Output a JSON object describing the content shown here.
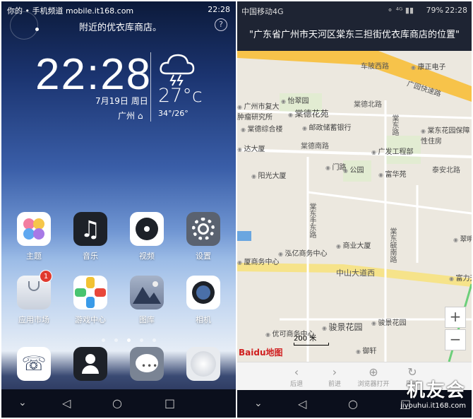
{
  "left": {
    "status": {
      "text": "你的 • 手机频道 mobile.it168.com",
      "time": "22:28"
    },
    "voice_hint": "附近的优衣库商店。",
    "help": "?",
    "clock": "22:28",
    "date": "7月19日  周日",
    "city": "广州 ⌂",
    "temp": "27°c",
    "temp_range": "34°/26°",
    "apps": [
      {
        "label": "主题"
      },
      {
        "label": "音乐"
      },
      {
        "label": "视频"
      },
      {
        "label": "设置"
      },
      {
        "label": "应用市场",
        "badge": "1"
      },
      {
        "label": "游戏中心"
      },
      {
        "label": "图库"
      },
      {
        "label": "相机"
      }
    ],
    "nav": {
      "back": "◁",
      "home": "○",
      "recent": "□",
      "down": "⌄"
    }
  },
  "right": {
    "status": {
      "carrier": "中国移动4G",
      "battery": "79%",
      "time": "22:28",
      "icons": "⚬ ⁴ᴳ ▮▮"
    },
    "header": "\"广东省广州市天河区棠东三担街优衣库商店的位置\"",
    "map": {
      "roads": [
        "车陂西路",
        "广园快速路",
        "棠德北路",
        "棠德南路",
        "中山大道西",
        "棠东路",
        "棠东手东路",
        "棠东毓南路",
        "泰安北路"
      ],
      "pois": [
        "康正电子",
        "怡翠园",
        "广州市复大肿瘤研究所",
        "棠德花苑",
        "棠德综合楼",
        "邮政储蓄银行",
        "棠东花园保障性住房",
        "达大厦",
        "广发工程部",
        "门路",
        "公园",
        "富华苑",
        "阳光大厦",
        "商业大厦",
        "泓亿商务中心",
        "厦商务中心",
        "骏景花园",
        "骏景花园",
        "富力天",
        "优可商务中心",
        "御轩",
        "翠明"
      ],
      "scale": "200 米",
      "zoom_in": "+",
      "zoom_out": "−",
      "logo": "Baidu地图"
    },
    "browser": {
      "back": "后退",
      "forward": "前进",
      "open": "浏览器打开",
      "refresh": "刷新"
    },
    "watermark": {
      "big": "机友会",
      "small": "jiyouhui.it168.com"
    },
    "nav": {
      "back": "◁",
      "home": "○",
      "recent": "□",
      "down": "⌄"
    }
  }
}
